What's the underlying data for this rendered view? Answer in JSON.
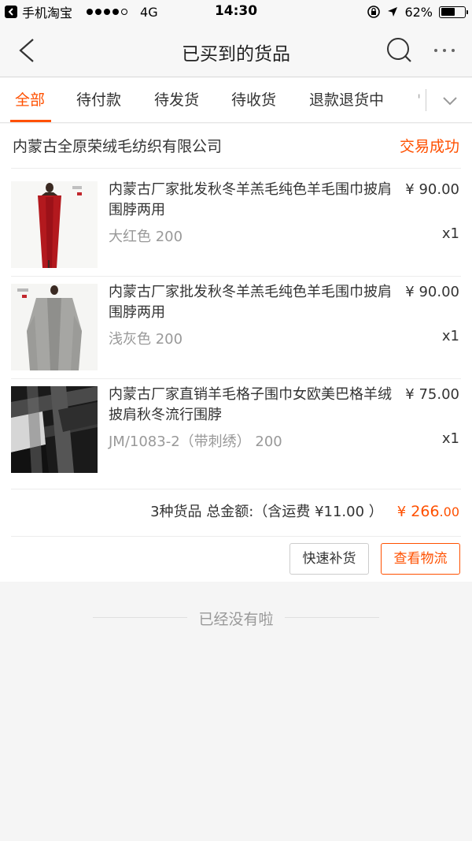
{
  "status_bar": {
    "back_app": "手机淘宝",
    "network": "4G",
    "time": "14:30",
    "battery": "62%",
    "battery_level": 0.62
  },
  "nav": {
    "title": "已买到的货品",
    "icons": [
      "back-icon",
      "search-icon",
      "more-icon"
    ]
  },
  "tabs": [
    {
      "label": "全部",
      "active": true
    },
    {
      "label": "待付款",
      "active": false
    },
    {
      "label": "待发货",
      "active": false
    },
    {
      "label": "待收货",
      "active": false
    },
    {
      "label": "退款退货中",
      "active": false
    },
    {
      "label": "'",
      "active": false
    }
  ],
  "order": {
    "shop_name": "内蒙古全原荣绒毛纺织有限公司",
    "status": "交易成功",
    "items": [
      {
        "title": "内蒙古厂家批发秋冬羊羔毛纯色羊毛围巾披肩围脖两用",
        "price": "¥ 90.00",
        "sku": "大红色 200",
        "qty": "x1",
        "thumb_color": "#b3191e"
      },
      {
        "title": "内蒙古厂家批发秋冬羊羔毛纯色羊毛围巾披肩围脖两用",
        "price": "¥ 90.00",
        "sku": "浅灰色 200",
        "qty": "x1",
        "thumb_color": "#9a9a98"
      },
      {
        "title": "内蒙古厂家直销羊毛格子围巾女欧美巴格羊绒披肩秋冬流行围脖",
        "price": "¥ 75.00",
        "sku": "JM/1083-2（带刺绣） 200",
        "qty": "x1",
        "thumb_color": "#2b2b2b"
      }
    ],
    "summary": "3种货品 总金额:（含运费 ¥11.00 ）",
    "total_symbol": "¥",
    "total_int": "266",
    "total_dec": ".00",
    "buttons": {
      "restock": "快速补货",
      "logistics": "查看物流"
    }
  },
  "end_text": "已经没有啦",
  "colors": {
    "accent": "#ff5000",
    "muted": "#999999"
  }
}
